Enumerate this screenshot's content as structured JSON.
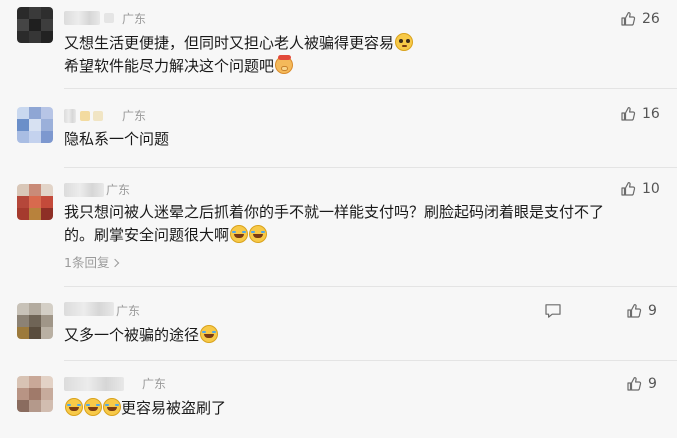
{
  "comments": [
    {
      "region": "广东",
      "text_lines": [
        "又想生活更便捷，但同时又担心老人被骗得更容易",
        "希望软件能尽力解决这个问题吧"
      ],
      "like_count": "26",
      "avatar_colors": [
        "#2a2a2a",
        "#3a3a3a",
        "#2e2e2e",
        "#454545",
        "#1f1f1f",
        "#3d3d3d",
        "#2b2b2b",
        "#363636",
        "#222222"
      ]
    },
    {
      "region": "广东",
      "text_lines": [
        "隐私系一个问题"
      ],
      "like_count": "16",
      "avatar_colors": [
        "#c9d8ef",
        "#8fa6d4",
        "#b7c5e6",
        "#6b8fc9",
        "#d7e1f2",
        "#9bb0da",
        "#a9bde3",
        "#c4d2ee",
        "#7d98cf"
      ]
    },
    {
      "region": "广东",
      "text_lines": [
        "我只想问被人迷晕之后抓着你的手不就一样能支付吗？刷脸起码闭着眼是支付不了",
        "的。刷掌安全问题很大啊"
      ],
      "like_count": "10",
      "replies_label": "1条回复",
      "avatar_colors": [
        "#d9c7b8",
        "#c98b78",
        "#e2d4c8",
        "#b5473a",
        "#d86a4e",
        "#c44a3a",
        "#a53a2e",
        "#b8823c",
        "#8e2f26"
      ]
    },
    {
      "region": "广东",
      "text_lines": [
        "又多一个被骗的途径"
      ],
      "like_count": "9",
      "avatar_colors": [
        "#c8c2b8",
        "#b3ab9f",
        "#d4cfc6",
        "#8c8275",
        "#6f6456",
        "#a09688",
        "#9c7a3c",
        "#5a4d3e",
        "#b9b0a3"
      ]
    },
    {
      "region": "广东",
      "text_lines": [
        "更容易被盗刷了"
      ],
      "like_count": "9",
      "avatar_colors": [
        "#d8c3b4",
        "#c9a898",
        "#e3d2c6",
        "#b89484",
        "#a07a6a",
        "#c7ab9c",
        "#8a6c5f",
        "#b4998b",
        "#d2bdb0"
      ]
    }
  ]
}
